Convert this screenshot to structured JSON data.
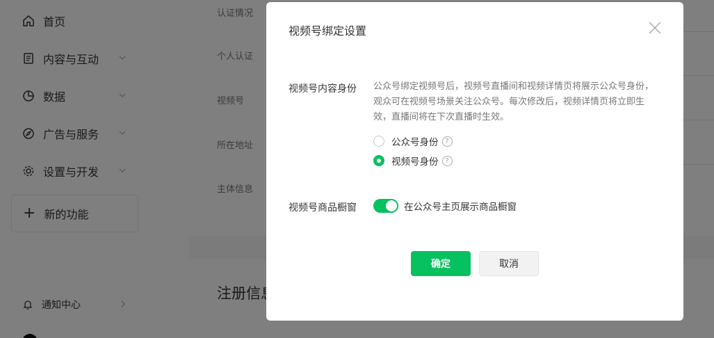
{
  "sidebar": {
    "items": [
      {
        "label": "首页",
        "icon": "home-icon"
      },
      {
        "label": "内容与互动",
        "icon": "document-icon"
      },
      {
        "label": "数据",
        "icon": "pie-chart-icon"
      },
      {
        "label": "广告与服务",
        "icon": "compass-icon"
      },
      {
        "label": "设置与开发",
        "icon": "gear-icon"
      }
    ],
    "new_feature": "新的功能",
    "notification": "通知中心"
  },
  "main": {
    "labels": [
      "认证情况",
      "个人认证",
      "视频号",
      "所在地址",
      "主体信息"
    ],
    "registration_title": "注册信息"
  },
  "modal": {
    "title": "视频号绑定设置",
    "identity_label": "视频号内容身份",
    "identity_desc": "公众号绑定视频号后，视频号直播间和视频详情页将展示公众号身份，观众可在视频号场景关注公众号。每次修改后，视频详情页将立即生效，直播间将在下次直播时生效。",
    "options": [
      {
        "label": "公众号身份",
        "checked": false
      },
      {
        "label": "视频号身份",
        "checked": true
      }
    ],
    "shop_label": "视频号商品橱窗",
    "shop_toggle_label": "在公众号主页展示商品橱窗",
    "shop_toggle_on": true,
    "confirm": "确定",
    "cancel": "取消"
  },
  "colors": {
    "accent": "#07c160",
    "overlay": "rgba(0,0,0,0.5)"
  }
}
